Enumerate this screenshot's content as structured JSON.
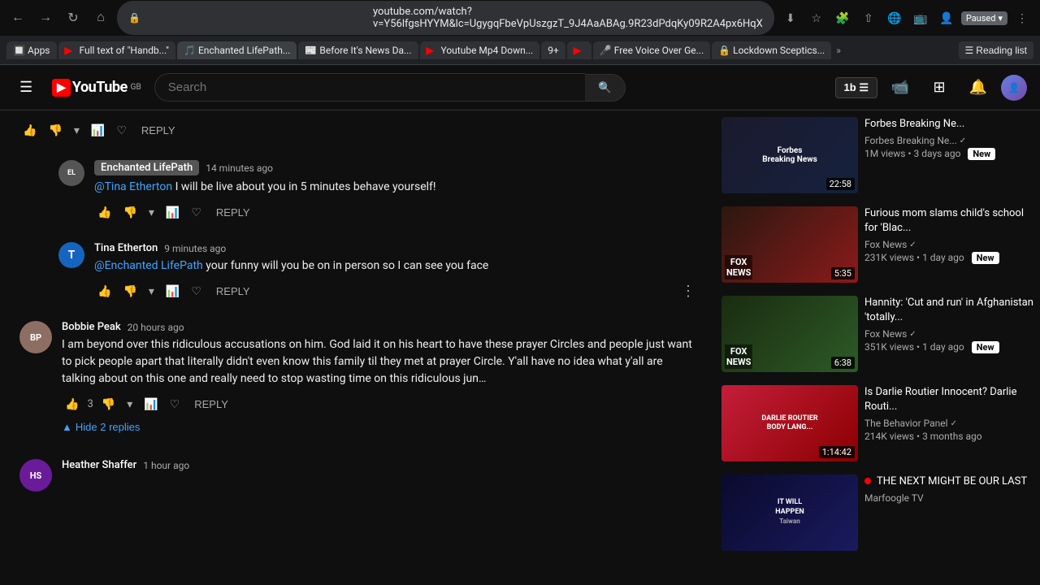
{
  "browser": {
    "nav": {
      "back": "←",
      "forward": "→",
      "refresh": "↻",
      "home": "⌂"
    },
    "address": "youtube.com/watch?v=Y56lfgsHYYM&lc=UgygqFbeVpUszgzT_9J4AaABAg.9R23dPdqKy09R2A4px6HqX",
    "paused_label": "Paused",
    "tabs": [
      {
        "icon": "apps",
        "label": "Apps",
        "favicon": "🔲"
      },
      {
        "icon": "yt",
        "label": "Full text of \"Handb...\"",
        "favicon": "📄"
      },
      {
        "icon": "enchanted",
        "label": "Enchanted LifePath...",
        "favicon": "🎵"
      },
      {
        "icon": "chrome",
        "label": "Before It's News Da...",
        "favicon": "📰"
      },
      {
        "icon": "yt2",
        "label": "Youtube Mp4 Down...",
        "favicon": "▶"
      },
      {
        "icon": "num",
        "label": "9+",
        "favicon": "🔢"
      },
      {
        "icon": "yt3",
        "label": "",
        "favicon": "▶"
      },
      {
        "icon": "free",
        "label": "Free Voice Over Ge...",
        "favicon": "🎤"
      },
      {
        "icon": "lockdown",
        "label": "Lockdown Sceptics...",
        "favicon": "🔒"
      }
    ],
    "reading_list": "Reading list"
  },
  "youtube": {
    "logo_text": "YouTube",
    "logo_gb": "GB",
    "search_placeholder": "Search",
    "counter_value": "1b",
    "header_actions": {
      "create": "📹",
      "apps": "⊞",
      "notifications": "🔔",
      "avatar": "👤"
    },
    "comments": [
      {
        "id": "enchanted",
        "avatar_bg": "#555",
        "avatar_text": "EL",
        "author": "Enchanted LifePath",
        "author_highlighted": true,
        "time": "14 minutes ago",
        "text": "@Tina Etherton I will be live about you in 5 minutes behave yourself!",
        "mention": "@Tina Etherton",
        "mention_text": " I will be live about you in 5 minutes behave yourself!",
        "likes": "",
        "is_reply": true
      },
      {
        "id": "tina",
        "avatar_bg": "#1565c0",
        "avatar_text": "T",
        "author": "Tina Etherton",
        "author_highlighted": false,
        "time": "9 minutes ago",
        "text": "@Enchanted LifePath your funny will you be on in person so I can see you face",
        "mention": "@Enchanted LifePath",
        "mention_text": " your funny will you be on in person so I can see you face",
        "likes": "",
        "is_reply": true
      },
      {
        "id": "bobbie",
        "avatar_bg": "#8d6e63",
        "avatar_text": "BP",
        "author": "Bobbie Peak",
        "author_highlighted": false,
        "time": "20 hours ago",
        "text": "I am beyond over this ridiculous accusations on him. God laid it on his heart to have these prayer Circles and people just want to pick people apart that literally didn't even know this family til they met at prayer Circle. Y'all have no idea what y'all are talking about on this one and really need to stop wasting time on this ridiculous jun…",
        "mention": "",
        "mention_text": "",
        "likes": "3",
        "is_reply": false
      },
      {
        "id": "heather",
        "avatar_bg": "#6a1b9a",
        "avatar_text": "HS",
        "author": "Heather Shaffer",
        "author_highlighted": false,
        "time": "1 hour ago",
        "text": "",
        "mention": "",
        "mention_text": "",
        "likes": "",
        "is_reply": false
      }
    ],
    "hide_replies": "Hide 2 replies",
    "reply_label": "REPLY",
    "sidebar_videos": [
      {
        "id": "forbes",
        "title": "Forbes Breaking Ne...",
        "channel": "Forbes Breaking Ne...",
        "verified": true,
        "views": "1M views",
        "age": "3 days ago",
        "duration": "22:58",
        "new_badge": true,
        "thumb_class": "thumb-forbes",
        "thumb_text": "Forbes"
      },
      {
        "id": "fox1",
        "title": "Furious mom slams child's school for 'Blac...",
        "channel": "Fox News",
        "verified": true,
        "views": "231K views",
        "age": "1 day ago",
        "duration": "5:35",
        "new_badge": true,
        "thumb_class": "thumb-fox1",
        "thumb_text": "FOX NEWS"
      },
      {
        "id": "fox2",
        "title": "Hannity: 'Cut and run' in Afghanistan 'totally...",
        "channel": "Fox News",
        "verified": true,
        "views": "351K views",
        "age": "1 day ago",
        "duration": "6:38",
        "new_badge": true,
        "thumb_class": "thumb-fox2",
        "thumb_text": "FOX NEWS"
      },
      {
        "id": "darlie",
        "title": "Is Darlie Routier Innocent? Darlie Routi...",
        "channel": "The Behavior Panel",
        "verified": true,
        "views": "214K views",
        "age": "3 months ago",
        "duration": "1:14:42",
        "new_badge": false,
        "thumb_class": "thumb-darlie",
        "thumb_text": "DARLIE ROUTIER BODY LANG..."
      },
      {
        "id": "marfoogle",
        "title": "THE NEXT MIGHT BE OUR LAST",
        "channel": "Marfoogle TV",
        "verified": false,
        "views": "",
        "age": "",
        "duration": "",
        "new_badge": false,
        "live": true,
        "thumb_class": "thumb-marfoogle",
        "thumb_text": "IT WILL HAPPEN"
      }
    ],
    "new_badge_text": "New"
  }
}
